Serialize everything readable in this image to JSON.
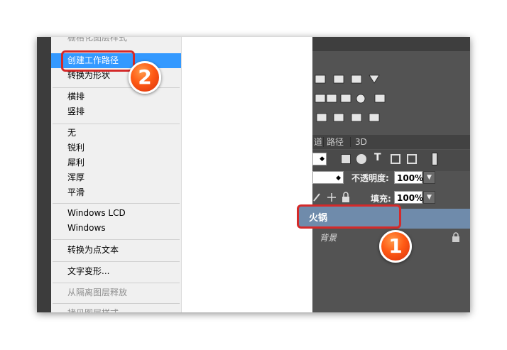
{
  "menu": {
    "items": [
      {
        "label": "栅格化图层样式",
        "state": "disabled-cut"
      },
      {
        "label": "创建工作路径",
        "state": "selected"
      },
      {
        "label": "转换为形状",
        "state": "normal"
      },
      {
        "label": "横排",
        "state": "normal"
      },
      {
        "label": "竖排",
        "state": "normal"
      },
      {
        "label": "无",
        "state": "normal"
      },
      {
        "label": "锐利",
        "state": "normal"
      },
      {
        "label": "犀利",
        "state": "normal"
      },
      {
        "label": "浑厚",
        "state": "normal"
      },
      {
        "label": "平滑",
        "state": "normal"
      },
      {
        "label": "Windows LCD",
        "state": "normal"
      },
      {
        "label": "Windows",
        "state": "normal"
      },
      {
        "label": "转换为点文本",
        "state": "normal"
      },
      {
        "label": "文字变形...",
        "state": "normal"
      },
      {
        "label": "从隔离图层释放",
        "state": "disabled"
      },
      {
        "label": "拷贝图层样式",
        "state": "disabled-cut"
      }
    ]
  },
  "panel": {
    "tabs": [
      "路径",
      "3D"
    ],
    "opacity_label": "不透明度:",
    "opacity_value": "100%",
    "fill_label": "填充:",
    "fill_value": "100%",
    "text_tool_glyph": "T",
    "layers": [
      {
        "name": "火锅",
        "selected": true
      },
      {
        "name": "背景",
        "selected": false,
        "locked": true
      }
    ]
  },
  "callouts": {
    "one": "1",
    "two": "2"
  },
  "colors": {
    "menu_highlight": "#3399ff",
    "panel_bg": "#535353",
    "layer_selected": "#6f8bab",
    "callout_red": "#d42a2a",
    "badge_orange": "#ff5a14"
  }
}
